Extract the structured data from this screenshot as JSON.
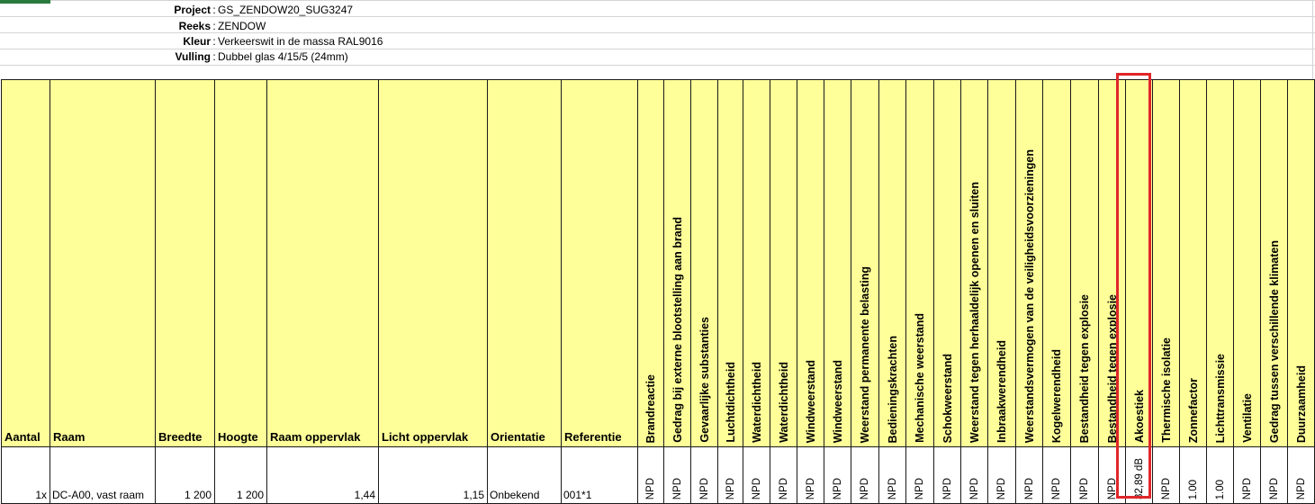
{
  "project_info": {
    "project": {
      "label": "Project",
      "value": "GS_ZENDOW20_SUG3247"
    },
    "reeks": {
      "label": "Reeks",
      "value": "ZENDOW"
    },
    "kleur": {
      "label": "Kleur",
      "value": "Verkeerswit in de massa RAL9016"
    },
    "vulling": {
      "label": "Vulling",
      "value": "Dubbel glas 4/15/5 (24mm)"
    },
    "colon": ":"
  },
  "headers": {
    "aantal": "Aantal",
    "raam": "Raam",
    "breedte": "Breedte",
    "hoogte": "Hoogte",
    "raam_oppervlak": "Raam oppervlak",
    "licht_oppervlak": "Licht oppervlak",
    "orientatie": "Orientatie",
    "referentie": "Referentie",
    "vertical": [
      "Brandreactie",
      "Gedrag bij externe blootstelling aan brand",
      "Gevaarlijke substanties",
      "Luchtdichtheid",
      "Waterdichtheid",
      "Waterdichtheid",
      "Windweerstand",
      "Windweerstand",
      "Weerstand permanente belasting",
      "Bedieningskrachten",
      "Mechanische weerstand",
      "Schokweerstand",
      "Weerstand tegen herhaaldelijk openen en sluiten",
      "Inbraakwerendheid",
      "Weerstandsvermogen van de veiligheidsvoorzieningen",
      "Kogelwerendheid",
      "Bestandheid tegen explosie",
      "Bestandheid tegen explosie",
      "Akoestiek",
      "Thermische isolatie",
      "Zonnefactor",
      "Lichttransmissie",
      "Ventilatie",
      "Gedrag tussen verschillende klimaten",
      "Duurzaamheid"
    ]
  },
  "row": {
    "aantal": "1x",
    "raam": "DC-A00, vast raam",
    "breedte": "1 200",
    "hoogte": "1 200",
    "raam_oppervlak": "1,44",
    "licht_oppervlak": "1,15",
    "orientatie": "Onbekend",
    "referentie": "001*1",
    "vertical": [
      "NPD",
      "NPD",
      "NPD",
      "NPD",
      "NPD",
      "NPD",
      "NPD",
      "NPD",
      "NPD",
      "NPD",
      "NPD",
      "NPD",
      "NPD",
      "NPD",
      "NPD",
      "NPD",
      "NPD",
      "NPD",
      "32,89 dB",
      "NPD",
      "1.00",
      "1.00",
      "NPD",
      "NPD",
      "NPD"
    ]
  },
  "colors": {
    "header_fill": "#ffff99",
    "highlight": "#e0262a",
    "excel_green": "#2a7a3f"
  }
}
